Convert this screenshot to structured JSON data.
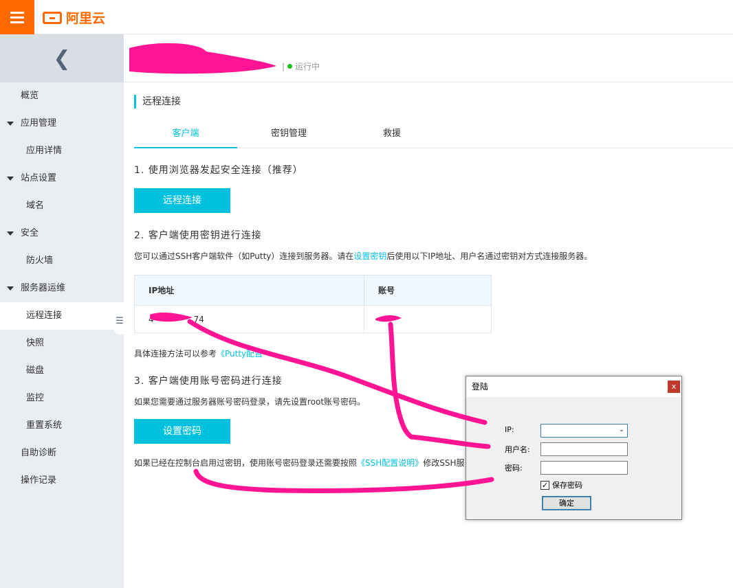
{
  "topbar": {
    "logo_text": "阿里云",
    "menu_icon": "hamburger-icon"
  },
  "sidebar": {
    "collapse_icon": "chevron-left-icon",
    "items": [
      {
        "label": "概览",
        "level": "top"
      },
      {
        "label": "应用管理",
        "level": "group"
      },
      {
        "label": "应用详情",
        "level": "sub"
      },
      {
        "label": "站点设置",
        "level": "group"
      },
      {
        "label": "域名",
        "level": "sub"
      },
      {
        "label": "安全",
        "level": "group"
      },
      {
        "label": "防火墙",
        "level": "sub"
      },
      {
        "label": "服务器运维",
        "level": "group"
      },
      {
        "label": "远程连接",
        "level": "sub",
        "active": true
      },
      {
        "label": "快照",
        "level": "sub"
      },
      {
        "label": "磁盘",
        "level": "sub"
      },
      {
        "label": "监控",
        "level": "sub"
      },
      {
        "label": "重置系统",
        "level": "sub"
      },
      {
        "label": "自助诊断",
        "level": "top"
      },
      {
        "label": "操作记录",
        "level": "top"
      }
    ]
  },
  "header": {
    "separator": "|",
    "status": "运行中"
  },
  "main": {
    "section_title": "远程连接",
    "tabs": [
      "客户端",
      "密钥管理",
      "救援"
    ],
    "step1": "1. 使用浏览器发起安全连接（推荐）",
    "remote_button": "远程连接",
    "step2": "2. 客户端使用密钥进行连接",
    "step2_desc_pre": "您可以通过SSH客户端软件（如Putty）连接到服务器。请在",
    "step2_desc_link": "设置密钥",
    "step2_desc_post": "后使用以下IP地址、用户名通过密钥对方式连接服务器。",
    "table": {
      "col_ip": "IP地址",
      "col_account": "账号",
      "ip_value_start": "4",
      "ip_value_end": "74",
      "account_value": ""
    },
    "ref_pre": "具体连接方法可以参考",
    "ref_link": "《Putty配置",
    "step3": "3. 客户端使用账号密码进行连接",
    "step3_desc": "如果您需要通过服务器账号密码登录，请先设置root账号密码。",
    "password_button": "设置密码",
    "footer_pre": "如果已经在控制台启用过密钥，使用账号密码登录还需要按照",
    "footer_link": "《SSH配置说明》",
    "footer_post": "修改SSH服"
  },
  "dialog": {
    "title": "登陆",
    "close": "x",
    "ip_label": "IP:",
    "user_label": "用户名:",
    "pwd_label": "密码:",
    "save_pwd": "保存密码",
    "save_checked": true,
    "ok": "确定"
  },
  "colors": {
    "accent": "#00c1de",
    "brand": "#ff6a00",
    "annotation": "#ff1493"
  }
}
